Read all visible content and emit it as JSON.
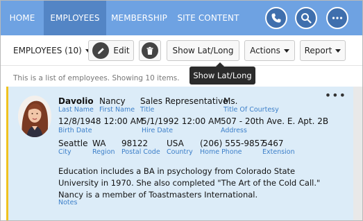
{
  "nav": {
    "items": [
      {
        "label": "HOME",
        "active": false
      },
      {
        "label": "EMPLOYEES",
        "active": true
      },
      {
        "label": "MEMBERSHIP",
        "active": false
      },
      {
        "label": "SITE CONTENT",
        "active": false
      }
    ],
    "icons": [
      "phone-icon",
      "search-icon",
      "more-icon"
    ]
  },
  "toolbar": {
    "view_label": "EMPLOYEES (10)",
    "edit_label": "Edit",
    "show_latlong_label": "Show Lat/Long",
    "actions_label": "Actions",
    "report_label": "Report"
  },
  "tooltip": {
    "text": "Show Lat/Long"
  },
  "info": {
    "text": "This is a list of employees. Showing 10 items."
  },
  "card": {
    "more_label": "•••",
    "fields": {
      "last_name": {
        "value": "Davolio",
        "label": "Last Name"
      },
      "first_name": {
        "value": "Nancy",
        "label": "First Name"
      },
      "title": {
        "value": "Sales Representative",
        "label": "Title"
      },
      "title_courtesy": {
        "value": "Ms.",
        "label": "Title Of Courtesy"
      },
      "birth_date": {
        "value": "12/8/1948 12:00 AM",
        "label": "Birth Date"
      },
      "hire_date": {
        "value": "5/1/1992 12:00 AM",
        "label": "Hire Date"
      },
      "address": {
        "value": "507 - 20th Ave. E. Apt. 2B",
        "label": "Address"
      },
      "city": {
        "value": "Seattle",
        "label": "City"
      },
      "region": {
        "value": "WA",
        "label": "Region"
      },
      "postal_code": {
        "value": "98122",
        "label": "Postal Code"
      },
      "country": {
        "value": "USA",
        "label": "Country"
      },
      "home_phone": {
        "value": "(206) 555-9857",
        "label": "Home Phone"
      },
      "extension": {
        "value": "5467",
        "label": "Extension"
      },
      "notes": {
        "value": "Education includes a BA in psychology from Colorado State University in 1970. She also completed \"The Art of the Cold Call.\" Nancy is a member of Toastmasters International.",
        "label": "Notes"
      }
    }
  },
  "colors": {
    "nav_bg": "#6ea2e2",
    "nav_active": "#5385c5",
    "card_bg": "#dcecf8",
    "card_accent": "#f0c21f",
    "label_blue": "#3c7fc9"
  }
}
